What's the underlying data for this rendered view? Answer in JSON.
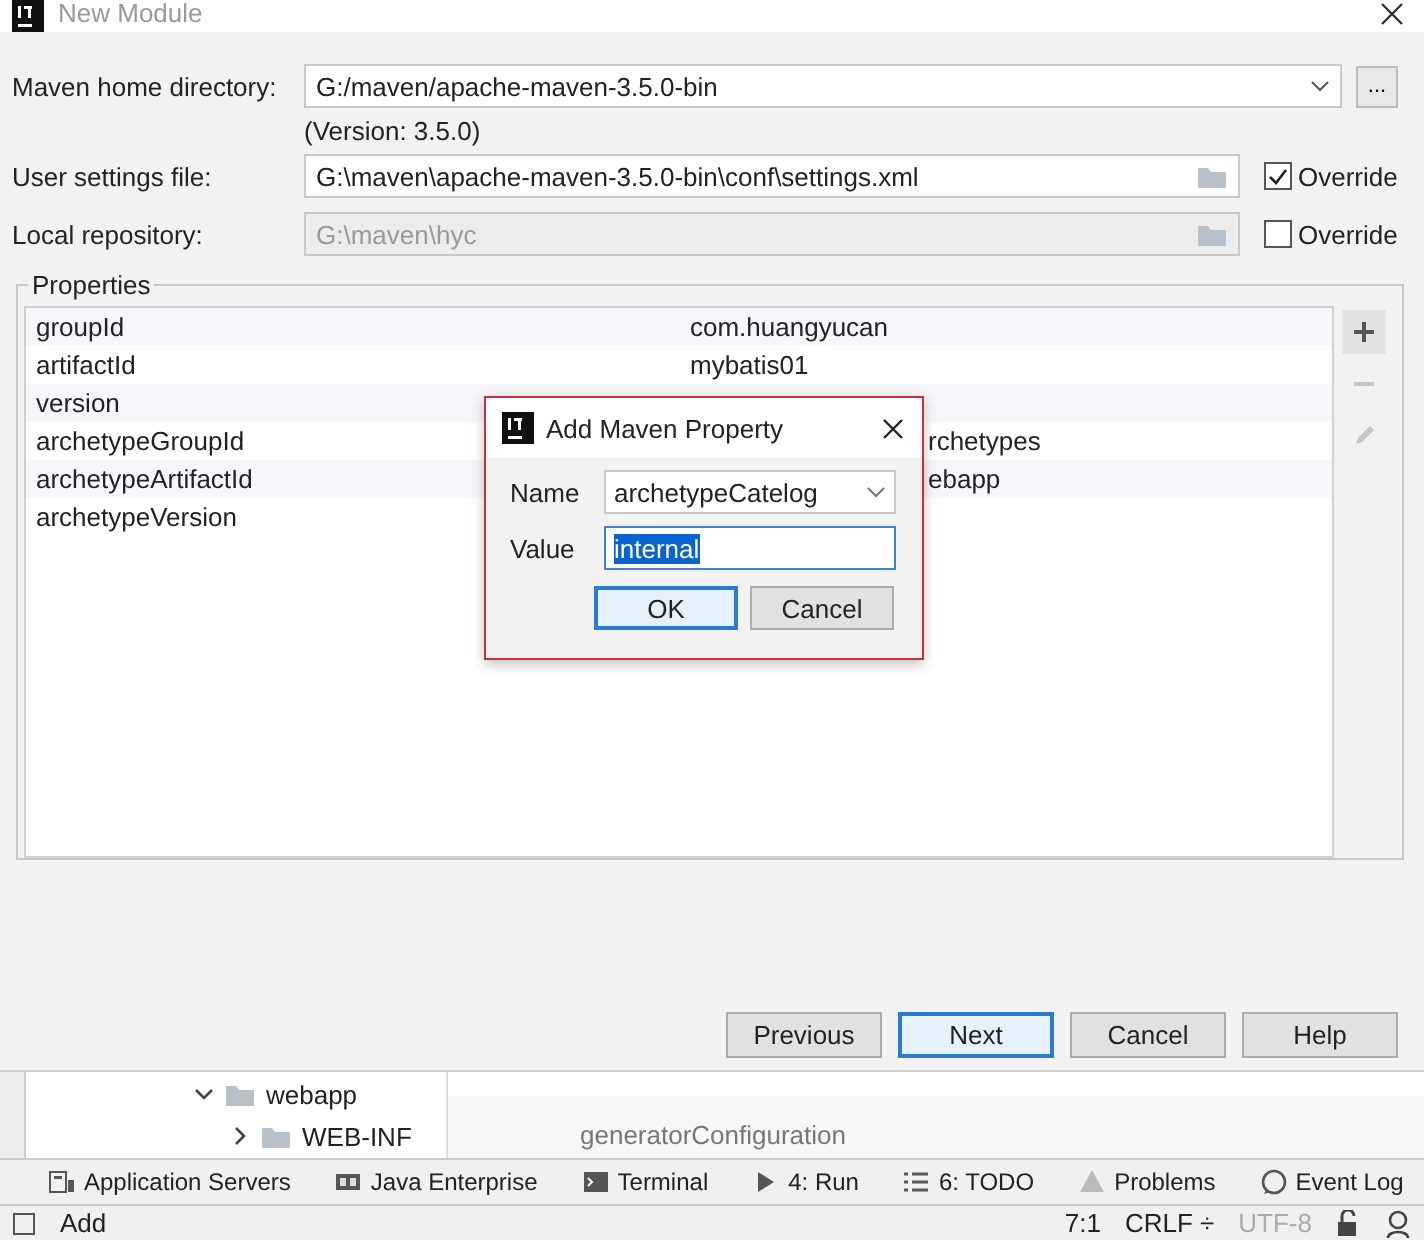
{
  "window": {
    "title": "New Module"
  },
  "maven_home": {
    "label": "Maven home directory:",
    "value": "G:/maven/apache-maven-3.5.0-bin",
    "browse": "..."
  },
  "version_note": "(Version: 3.5.0)",
  "user_settings": {
    "label": "User settings file:",
    "value": "G:\\maven\\apache-maven-3.5.0-bin\\conf\\settings.xml",
    "disabled": false,
    "override": {
      "label": "Override",
      "checked": true
    }
  },
  "local_repository": {
    "label": "Local repository:",
    "value": "G:\\maven\\hyc",
    "disabled": true,
    "override": {
      "label": "Override",
      "checked": false
    }
  },
  "properties": {
    "title": "Properties",
    "rows": [
      {
        "name": "groupId",
        "value": "com.huangyucan",
        "kind": "full"
      },
      {
        "name": "artifactId",
        "value": "mybatis01",
        "kind": "full"
      },
      {
        "name": "version",
        "kind": "hidden"
      },
      {
        "name": "archetypeGroupId",
        "value": "rchetypes",
        "kind": "clipped"
      },
      {
        "name": "archetypeArtifactId",
        "value": "ebapp",
        "kind": "clipped"
      },
      {
        "name": "archetypeVersion",
        "kind": "hidden"
      }
    ],
    "tools": [
      {
        "kind": "add",
        "disabled": false
      },
      {
        "kind": "remove",
        "disabled": true
      },
      {
        "kind": "edit",
        "disabled": true
      }
    ]
  },
  "buttons": [
    {
      "label": "Previous",
      "default": false
    },
    {
      "label": "Next",
      "default": true
    },
    {
      "label": "Cancel",
      "default": false
    },
    {
      "label": "Help",
      "default": false
    }
  ],
  "add_property_dialog": {
    "title": "Add Maven Property",
    "name_label": "Name",
    "name_value": "archetypeCatelog",
    "value_label": "Value",
    "value": "internal",
    "buttons": [
      {
        "label": "OK",
        "default": true
      },
      {
        "label": "Cancel",
        "default": false
      }
    ]
  },
  "ide": {
    "tree": [
      {
        "label": "webapp",
        "expanded": true,
        "children": [
          {
            "label": "WEB-INF",
            "expanded": false
          }
        ]
      }
    ],
    "editor_text": "generatorConfiguration",
    "tool_tabs": [
      {
        "label": "Application Servers",
        "kind": "servers"
      },
      {
        "label": "Java Enterprise",
        "kind": "enterprise"
      },
      {
        "label": "Terminal",
        "kind": "terminal"
      },
      {
        "label": "4: Run",
        "kind": "run"
      },
      {
        "label": "6: TODO",
        "kind": "todo"
      },
      {
        "label": "Problems",
        "kind": "problems"
      },
      {
        "label": "Event Log",
        "kind": "log"
      }
    ],
    "status": {
      "message": "Add",
      "position": "7:1",
      "line_separator": "CRLF ÷",
      "encoding": "UTF-8"
    }
  }
}
